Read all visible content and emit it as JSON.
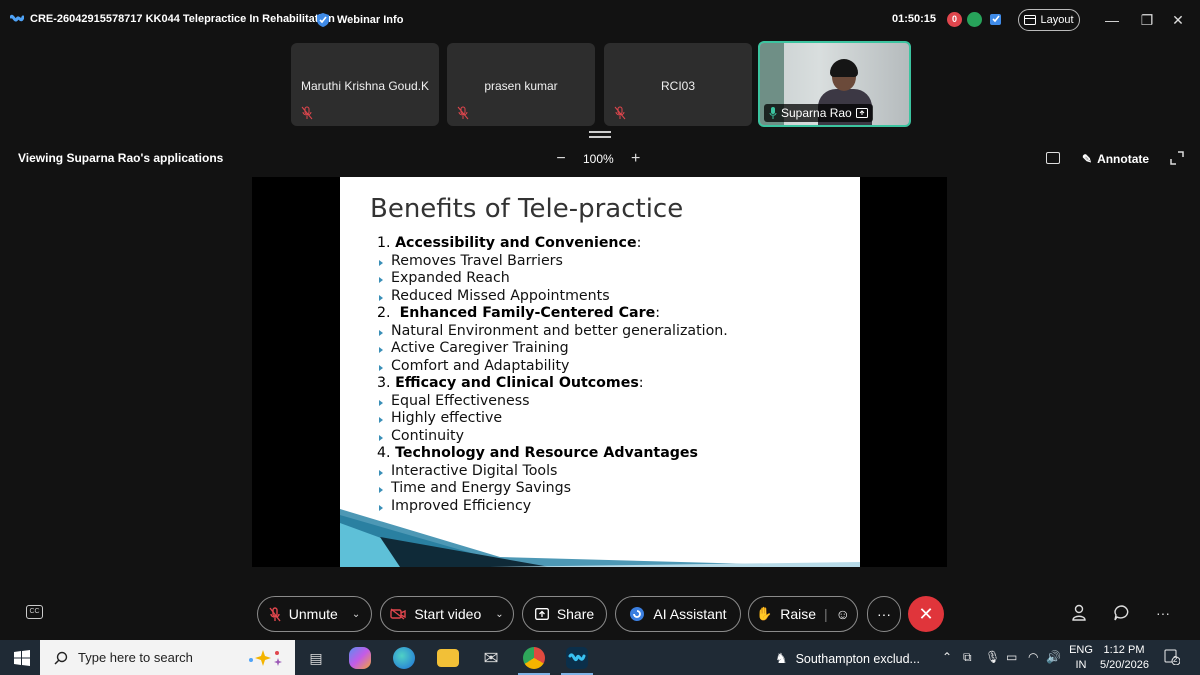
{
  "window": {
    "title": "CRE-26042915578717 KK044 Telepractice In Rehabilitation",
    "webinar_info": "Webinar Info",
    "timer": "01:50:15",
    "rec_badge": "0",
    "layout_label": "Layout",
    "window_controls": [
      "minimize",
      "restore",
      "close"
    ]
  },
  "participants": [
    {
      "name": "Maruthi Krishna Goud.K",
      "muted": true
    },
    {
      "name": "prasen kumar",
      "muted": true
    },
    {
      "name": "RCI03",
      "muted": true
    },
    {
      "name": "Suparna Rao",
      "muted": false,
      "video": true,
      "active_speaker": true
    }
  ],
  "share_bar": {
    "viewing_text": "Viewing Suparna Rao's applications",
    "zoom_minus": "−",
    "zoom_level": "100%",
    "zoom_plus": "+",
    "annotate_label": "Annotate"
  },
  "slide": {
    "title": "Benefits of Tele-practice",
    "sections": [
      {
        "num": "1.",
        "heading": "Accessibility and Convenience",
        "suffix": ":",
        "items": [
          "Removes Travel Barriers",
          "Expanded Reach",
          "Reduced Missed Appointments"
        ]
      },
      {
        "num": "2.",
        "heading": "Enhanced Family-Centered Care",
        "suffix": ":",
        "items": [
          "Natural Environment and better generalization.",
          "Active Caregiver Training",
          "Comfort and Adaptability"
        ]
      },
      {
        "num": "3.",
        "heading": "Efficacy and Clinical Outcomes",
        "suffix": ":",
        "items": [
          "Equal Effectiveness",
          "Highly effective",
          "Continuity"
        ]
      },
      {
        "num": "4.",
        "heading": "Technology and Resource Advantages",
        "suffix": "",
        "items": [
          "Interactive Digital Tools",
          "Time and Energy Savings",
          "Improved Efficiency"
        ]
      }
    ]
  },
  "controls": {
    "unmute": "Unmute",
    "start_video": "Start video",
    "share": "Share",
    "ai_assistant": "AI Assistant",
    "raise": "Raise",
    "more": "···",
    "end": "✕"
  },
  "taskbar": {
    "search_placeholder": "Type here to search",
    "news_text": "Southampton exclud...",
    "lang_top": "ENG",
    "lang_bottom": "IN",
    "time": "1:12 PM",
    "date": "5/20/2026",
    "notifications": "2"
  },
  "colors": {
    "accent_speaker": "#3cc4a0",
    "end_call": "#e0353b",
    "slide_bullet": "#3a8fb7"
  }
}
